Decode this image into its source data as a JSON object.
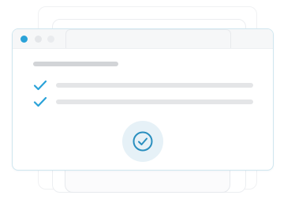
{
  "window": {
    "controls": [
      "close-dot",
      "minimize-dot",
      "maximize-dot"
    ]
  },
  "checklist": {
    "items": [
      {
        "checked": true
      },
      {
        "checked": true
      }
    ]
  },
  "badge": {
    "icon": "check-circle-icon"
  },
  "colors": {
    "accent": "#2aa2d8",
    "badge_bg": "#e6f1f7",
    "border": "#cfe6ef",
    "placeholder_bar": "#e4e5e7",
    "heading_bar": "#d2d4d7"
  }
}
